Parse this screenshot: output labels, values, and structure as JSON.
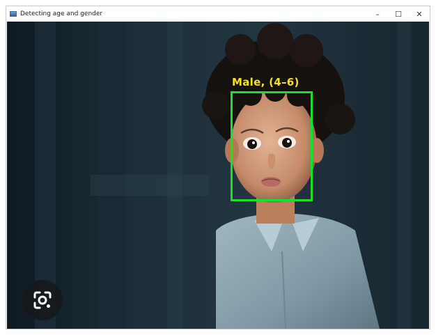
{
  "window": {
    "title": "Detecting age and gender",
    "controls": {
      "minimize": "–",
      "maximize": "☐",
      "close": "✕"
    }
  },
  "detection": {
    "label": "Male, (4–6)",
    "box_color": "#18e418",
    "label_color": "#f2e21d"
  },
  "overlay": {
    "lens_icon": "google-lens-camera-icon"
  }
}
